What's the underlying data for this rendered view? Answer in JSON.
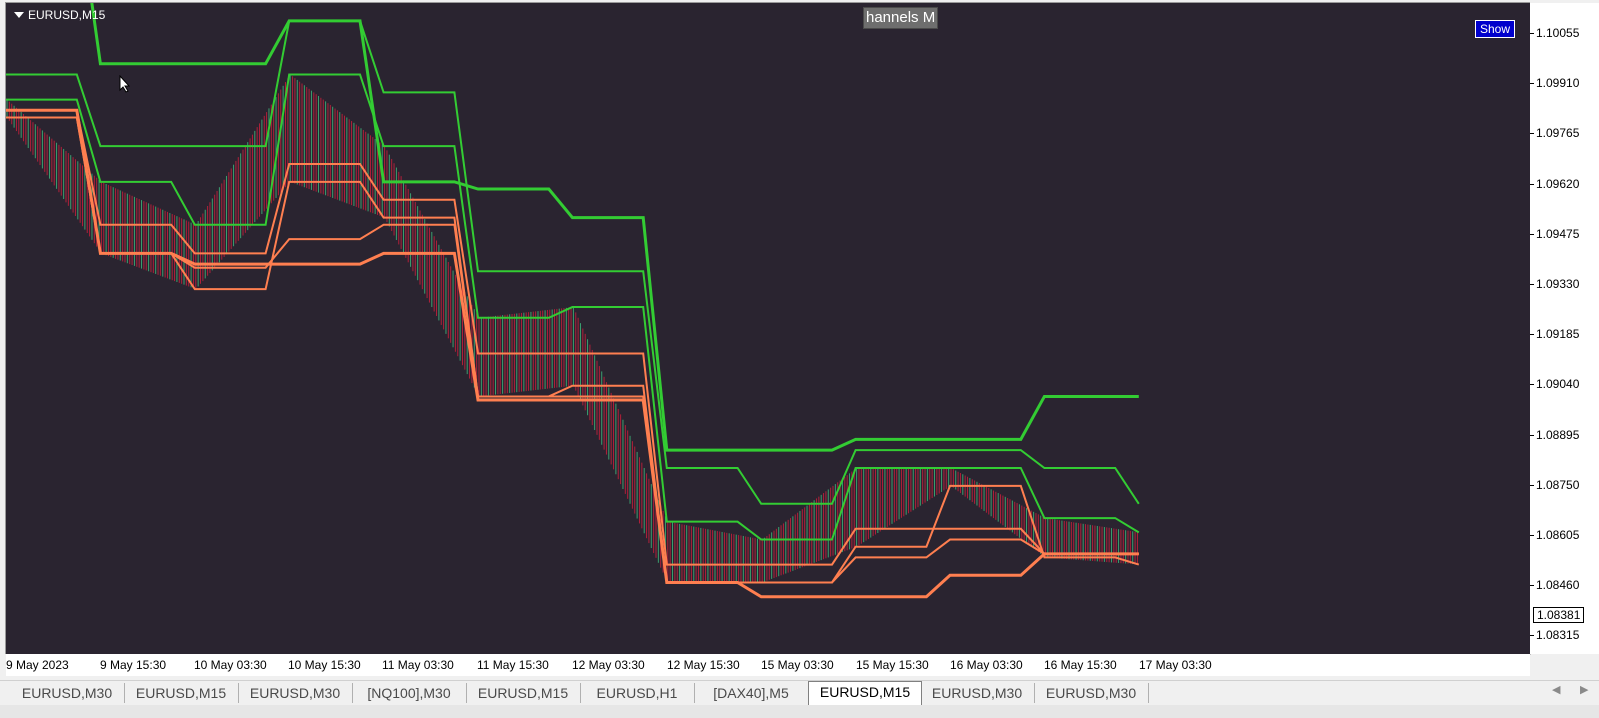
{
  "chart": {
    "symbol_label": "EURUSD,M15",
    "indicator_title": "hannels M",
    "show_button": "Show",
    "current_price": "1.08381",
    "price_ticks": [
      "1.10055",
      "1.09910",
      "1.09765",
      "1.09620",
      "1.09475",
      "1.09330",
      "1.09185",
      "1.09040",
      "1.08895",
      "1.08750",
      "1.08605",
      "1.08460",
      "1.08315"
    ],
    "time_ticks": [
      "9 May 2023",
      "9 May 15:30",
      "10 May 03:30",
      "10 May 15:30",
      "11 May 03:30",
      "11 May 15:30",
      "12 May 03:30",
      "12 May 15:30",
      "15 May 03:30",
      "15 May 15:30",
      "16 May 03:30",
      "16 May 15:30",
      "17 May 03:30"
    ],
    "colors": {
      "background": "#2a2430",
      "upper_channel": "#33cc33",
      "lower_channel": "#ff7f50",
      "candles_down": "#b0203a",
      "candles_up": "#3aa070"
    }
  },
  "chart_data": {
    "type": "line",
    "x": [
      "9 May 2023",
      "9 May 15:30",
      "10 May 03:30",
      "10 May 15:30",
      "11 May 03:30",
      "11 May 15:30",
      "12 May 03:30",
      "12 May 15:30",
      "15 May 03:30",
      "15 May 15:30",
      "16 May 03:30",
      "16 May 15:30",
      "17 May 03:30"
    ],
    "ylim": [
      1.0828,
      1.101
    ],
    "series": [
      {
        "values": [
          1.104,
          1.0993,
          1.0993,
          1.1005,
          1.096,
          1.0958,
          1.095,
          1.0885,
          1.0885,
          1.0888,
          1.0888,
          1.09,
          1.09
        ]
      },
      {
        "values": [
          1.099,
          1.097,
          1.097,
          1.1005,
          1.0985,
          1.0935,
          1.0935,
          1.088,
          1.087,
          1.0885,
          1.0885,
          1.088,
          1.087
        ]
      },
      {
        "values": [
          1.0983,
          1.096,
          1.0948,
          1.099,
          1.097,
          1.0922,
          1.0925,
          1.0865,
          1.086,
          1.088,
          1.088,
          1.0866,
          1.0862
        ]
      },
      {
        "values": [
          1.098,
          1.0948,
          1.094,
          1.0965,
          1.0955,
          1.0912,
          1.0912,
          1.0853,
          1.0853,
          1.0863,
          1.0863,
          1.0856,
          1.0856
        ]
      },
      {
        "values": [
          1.0978,
          1.094,
          1.093,
          1.096,
          1.095,
          1.09,
          1.0903,
          1.0848,
          1.0848,
          1.0858,
          1.0875,
          1.0855,
          1.0853
        ]
      },
      {
        "values": [
          1.0978,
          1.094,
          1.0936,
          1.0944,
          1.0948,
          1.09,
          1.09,
          1.0848,
          1.0848,
          1.0855,
          1.086,
          1.0856,
          1.0856
        ]
      },
      {
        "values": [
          1.098,
          1.094,
          1.0937,
          1.0937,
          1.094,
          1.0899,
          1.0899,
          1.0848,
          1.0844,
          1.0844,
          1.085,
          1.0856,
          1.0856
        ]
      }
    ]
  },
  "tabs": [
    {
      "label": "EURUSD,M30",
      "active": false
    },
    {
      "label": "EURUSD,M15",
      "active": false
    },
    {
      "label": "EURUSD,M30",
      "active": false
    },
    {
      "label": "[NQ100],M30",
      "active": false
    },
    {
      "label": "EURUSD,M15",
      "active": false
    },
    {
      "label": "EURUSD,H1",
      "active": false
    },
    {
      "label": "[DAX40],M5",
      "active": false
    },
    {
      "label": "EURUSD,M15",
      "active": true
    },
    {
      "label": "EURUSD,M30",
      "active": false
    },
    {
      "label": "EURUSD,M30",
      "active": false
    }
  ],
  "scroll": {
    "left_icon": "chevron-left-icon",
    "right_icon": "chevron-right-icon"
  }
}
